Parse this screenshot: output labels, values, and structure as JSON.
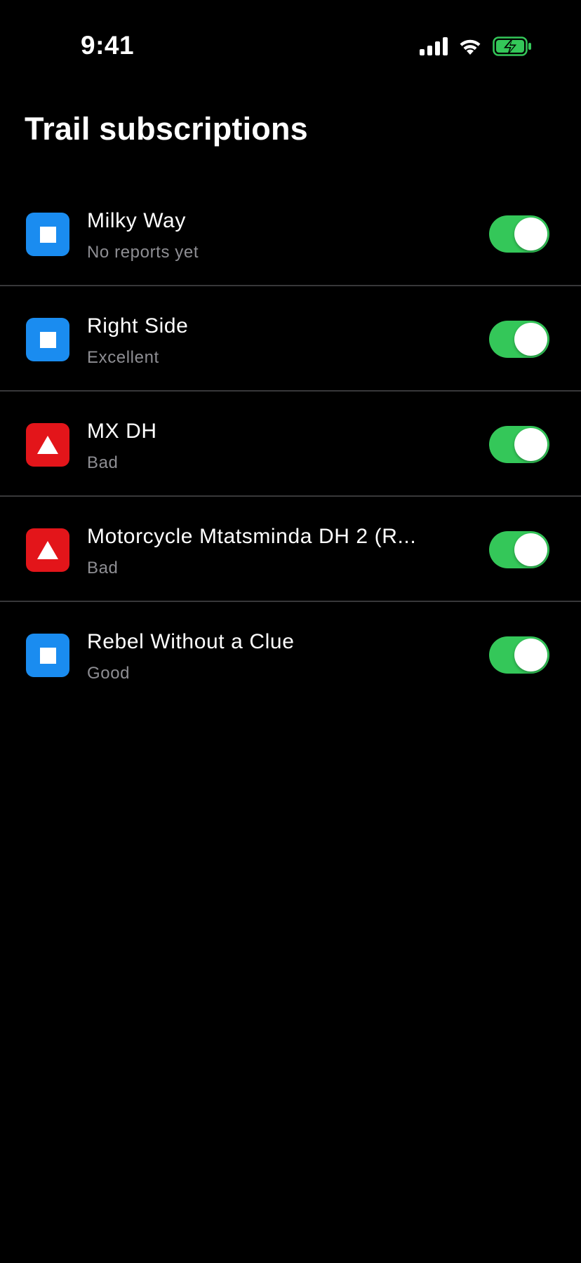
{
  "status_bar": {
    "time": "9:41",
    "battery_color": "#34c759"
  },
  "page": {
    "title": "Trail subscriptions"
  },
  "colors": {
    "blue": "#1a8cf0",
    "red": "#e3151a",
    "toggle_on": "#34c759"
  },
  "trails": [
    {
      "name": "Milky Way",
      "status": "No reports yet",
      "icon": "square-icon",
      "icon_color": "blue",
      "subscribed": true
    },
    {
      "name": "Right Side",
      "status": "Excellent",
      "icon": "square-icon",
      "icon_color": "blue",
      "subscribed": true
    },
    {
      "name": "MX DH",
      "status": "Bad",
      "icon": "triangle-icon",
      "icon_color": "red",
      "subscribed": true
    },
    {
      "name": "Motorcycle Mtatsminda DH 2 (R...",
      "status": "Bad",
      "icon": "triangle-icon",
      "icon_color": "red",
      "subscribed": true
    },
    {
      "name": "Rebel Without a Clue",
      "status": "Good",
      "icon": "square-icon",
      "icon_color": "blue",
      "subscribed": true
    }
  ]
}
